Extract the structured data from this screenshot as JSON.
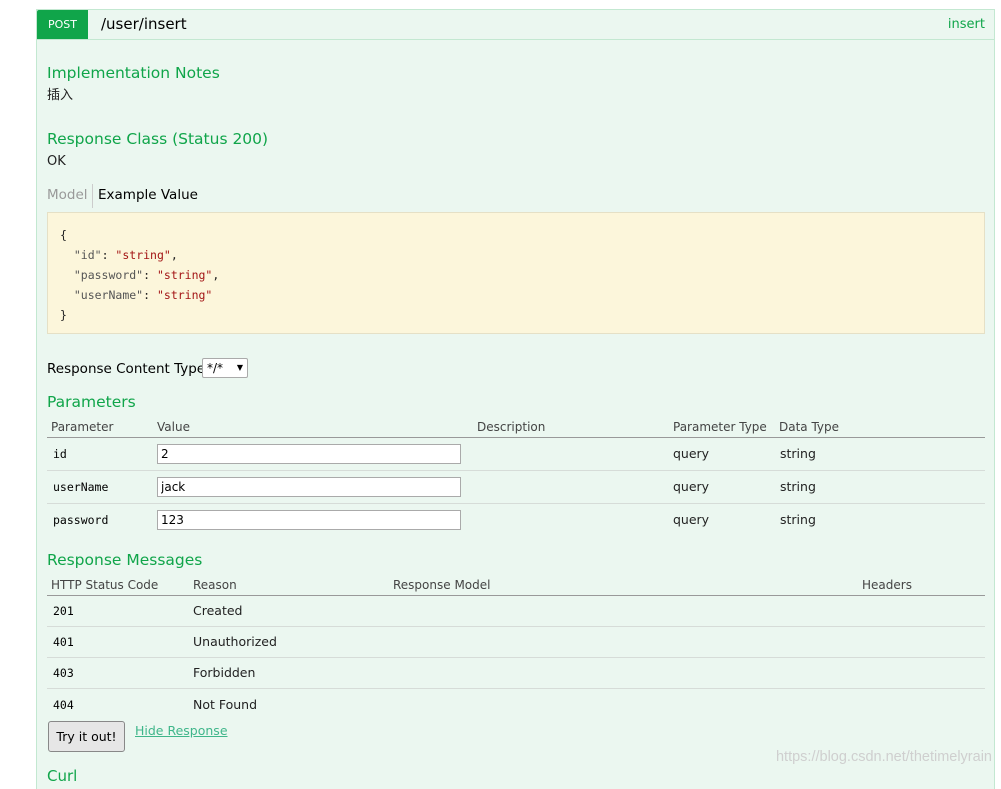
{
  "operation": {
    "method": "POST",
    "path": "/user/insert",
    "summary": "insert"
  },
  "implementation_notes": {
    "heading": "Implementation Notes",
    "text": "插入"
  },
  "response_class": {
    "heading": "Response Class (Status 200)",
    "text": "OK",
    "tabs": {
      "model": "Model",
      "example": "Example Value"
    },
    "example_json": {
      "open": "{",
      "close": "}",
      "fields": [
        {
          "key": "\"id\"",
          "value": "\"string\"",
          "comma": ","
        },
        {
          "key": "\"password\"",
          "value": "\"string\"",
          "comma": ","
        },
        {
          "key": "\"userName\"",
          "value": "\"string\"",
          "comma": ""
        }
      ]
    }
  },
  "response_content_type": {
    "label": "Response Content Type",
    "selected": "*/*"
  },
  "parameters": {
    "heading": "Parameters",
    "columns": [
      "Parameter",
      "Value",
      "Description",
      "Parameter Type",
      "Data Type"
    ],
    "rows": [
      {
        "name": "id",
        "value": "2",
        "description": "",
        "param_type": "query",
        "data_type": "string"
      },
      {
        "name": "userName",
        "value": "jack",
        "description": "",
        "param_type": "query",
        "data_type": "string"
      },
      {
        "name": "password",
        "value": "123",
        "description": "",
        "param_type": "query",
        "data_type": "string"
      }
    ]
  },
  "response_messages": {
    "heading": "Response Messages",
    "columns": [
      "HTTP Status Code",
      "Reason",
      "Response Model",
      "Headers"
    ],
    "rows": [
      {
        "code": "201",
        "reason": "Created"
      },
      {
        "code": "401",
        "reason": "Unauthorized"
      },
      {
        "code": "403",
        "reason": "Forbidden"
      },
      {
        "code": "404",
        "reason": "Not Found"
      }
    ]
  },
  "actions": {
    "try_label": "Try it out!",
    "hide_label": "Hide Response"
  },
  "curl_heading": "Curl",
  "watermark": "https://blog.csdn.net/thetimelyrain",
  "colors": {
    "accent_green": "#10a54a",
    "panel_bg": "#ebf7f0",
    "sample_bg": "#fcf6db",
    "link_color": "#3fb68a"
  }
}
